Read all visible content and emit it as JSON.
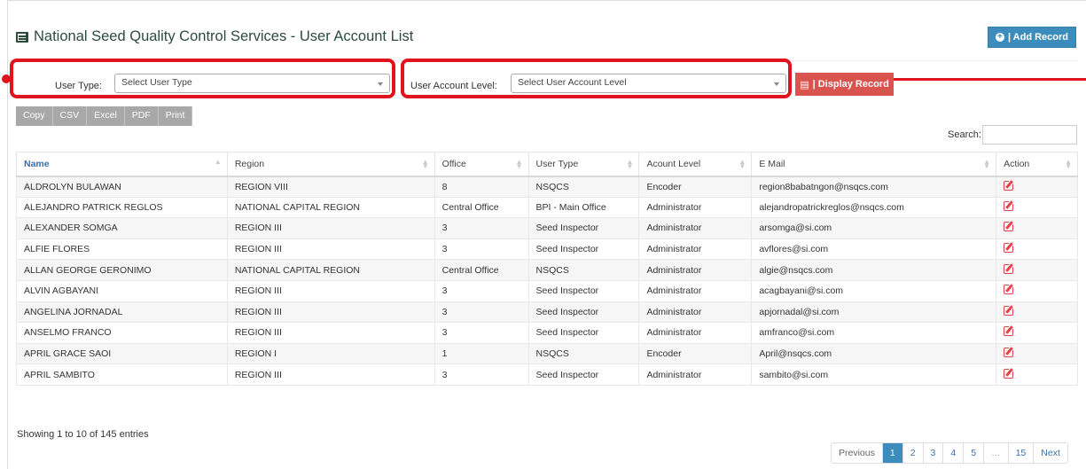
{
  "page_title": "National Seed Quality Control Services - User Account List",
  "add_record": "| Add Record",
  "filters": {
    "user_type_label": "User Type:",
    "user_type_value": "Select User Type",
    "account_level_label": "User Account Level:",
    "account_level_value": "Select User Account Level",
    "display_button": "| Display Record"
  },
  "export_buttons": [
    "Copy",
    "CSV",
    "Excel",
    "PDF",
    "Print"
  ],
  "search_label": "Search:",
  "columns": [
    "Name",
    "Region",
    "Office",
    "User Type",
    "Acount Level",
    "E Mail",
    "Action"
  ],
  "rows": [
    [
      "ALDROLYN BULAWAN",
      "REGION VIII",
      "8",
      "NSQCS",
      "Encoder",
      "region8babatngon@nsqcs.com"
    ],
    [
      "ALEJANDRO PATRICK REGLOS",
      "NATIONAL CAPITAL REGION",
      "Central Office",
      "BPI - Main Office",
      "Administrator",
      "alejandropatrickreglos@nsqcs.com"
    ],
    [
      "ALEXANDER SOMGA",
      "REGION III",
      "3",
      "Seed Inspector",
      "Administrator",
      "arsomga@si.com"
    ],
    [
      "ALFIE FLORES",
      "REGION III",
      "3",
      "Seed Inspector",
      "Administrator",
      "avflores@si.com"
    ],
    [
      "ALLAN GEORGE GERONIMO",
      "NATIONAL CAPITAL REGION",
      "Central Office",
      "NSQCS",
      "Administrator",
      "algie@nsqcs.com"
    ],
    [
      "ALVIN AGBAYANI",
      "REGION III",
      "3",
      "Seed Inspector",
      "Administrator",
      "acagbayani@si.com"
    ],
    [
      "ANGELINA JORNADAL",
      "REGION III",
      "3",
      "Seed Inspector",
      "Administrator",
      "apjornadal@si.com"
    ],
    [
      "ANSELMO FRANCO",
      "REGION III",
      "3",
      "Seed Inspector",
      "Administrator",
      "amfranco@si.com"
    ],
    [
      "APRIL GRACE SAOI",
      "REGION I",
      "1",
      "NSQCS",
      "Encoder",
      "April@nsqcs.com"
    ],
    [
      "APRIL SAMBITO",
      "REGION III",
      "3",
      "Seed Inspector",
      "Administrator",
      "sambito@si.com"
    ]
  ],
  "entries_info": "Showing 1 to 10 of 145 entries",
  "pagination": {
    "previous": "Previous",
    "pages": [
      "1",
      "2",
      "3",
      "4",
      "5",
      "…",
      "15"
    ],
    "next": "Next"
  },
  "colors": {
    "accent": "#3c8dbc",
    "highlight": "#e0141d",
    "display_button": "#d9534f"
  }
}
